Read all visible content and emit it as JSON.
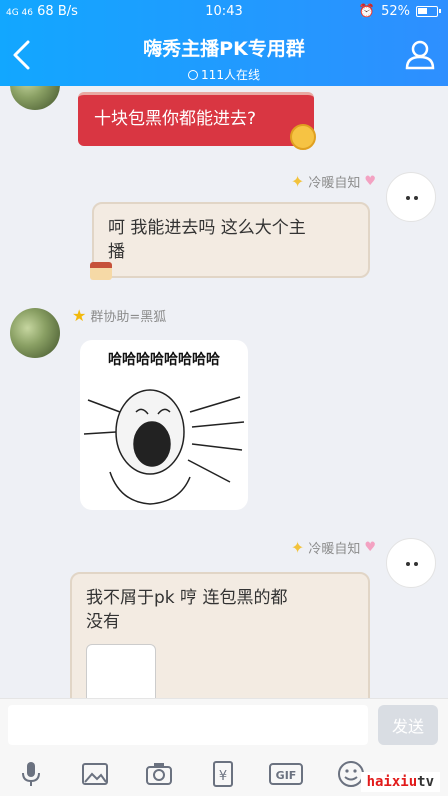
{
  "status": {
    "network": "4G 46",
    "speed": "68 B/s",
    "time": "10:43",
    "battery": "52%"
  },
  "header": {
    "title": "嗨秀主播PK专用群",
    "online": "111人在线"
  },
  "messages": [
    {
      "sender": "",
      "text": "十块包黑你都能进去?"
    },
    {
      "sender": "冷暖自知",
      "text_line1": "呵 我能进去吗 这么大个主",
      "text_line2": "播"
    },
    {
      "sender": "群协助=黑狐",
      "sticker_text": "哈哈哈哈哈哈哈哈"
    },
    {
      "sender": "冷暖自知",
      "text_line1": "我不屑于pk 哼 连包黑的都",
      "text_line2": "没有"
    }
  ],
  "input": {
    "placeholder": "",
    "send_label": "发送"
  },
  "watermark": {
    "brand_red": "haixiu",
    "brand_dark": "tv"
  },
  "colors": {
    "header": "#1e9bff",
    "red_bubble": "#d93642",
    "tan_bubble": "#f3ebe2"
  }
}
